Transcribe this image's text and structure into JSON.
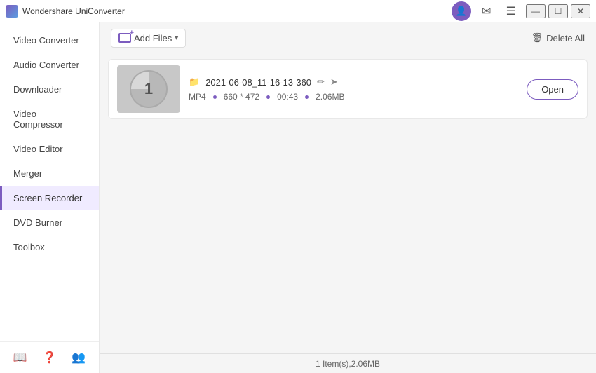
{
  "app": {
    "title": "Wondershare UniConverter"
  },
  "titlebar": {
    "logo_alt": "Wondershare logo",
    "title": "Wondershare UniConverter",
    "user_icon": "👤",
    "mail_icon": "✉",
    "menu_icon": "☰",
    "minimize_icon": "—",
    "maximize_icon": "☐",
    "close_icon": "✕"
  },
  "sidebar": {
    "items": [
      {
        "id": "video-converter",
        "label": "Video Converter",
        "active": false
      },
      {
        "id": "audio-converter",
        "label": "Audio Converter",
        "active": false
      },
      {
        "id": "downloader",
        "label": "Downloader",
        "active": false
      },
      {
        "id": "video-compressor",
        "label": "Video Compressor",
        "active": false
      },
      {
        "id": "video-editor",
        "label": "Video Editor",
        "active": false
      },
      {
        "id": "merger",
        "label": "Merger",
        "active": false
      },
      {
        "id": "screen-recorder",
        "label": "Screen Recorder",
        "active": true
      },
      {
        "id": "dvd-burner",
        "label": "DVD Burner",
        "active": false
      },
      {
        "id": "toolbox",
        "label": "Toolbox",
        "active": false
      }
    ],
    "footer": {
      "book_icon": "📖",
      "help_icon": "❓",
      "users_icon": "👥"
    }
  },
  "toolbar": {
    "add_file_label": "Add Files",
    "delete_all_label": "Delete All",
    "delete_icon": "🗑"
  },
  "file_item": {
    "thumbnail_number": "1",
    "folder_icon": "📁",
    "filename": "2021-06-08_11-16-13-360",
    "edit_icon": "✏",
    "share_icon": "➤",
    "format": "MP4",
    "resolution": "660 * 472",
    "duration": "00:43",
    "size": "2.06MB",
    "open_label": "Open"
  },
  "status_bar": {
    "text": "1 Item(s),2.06MB"
  }
}
